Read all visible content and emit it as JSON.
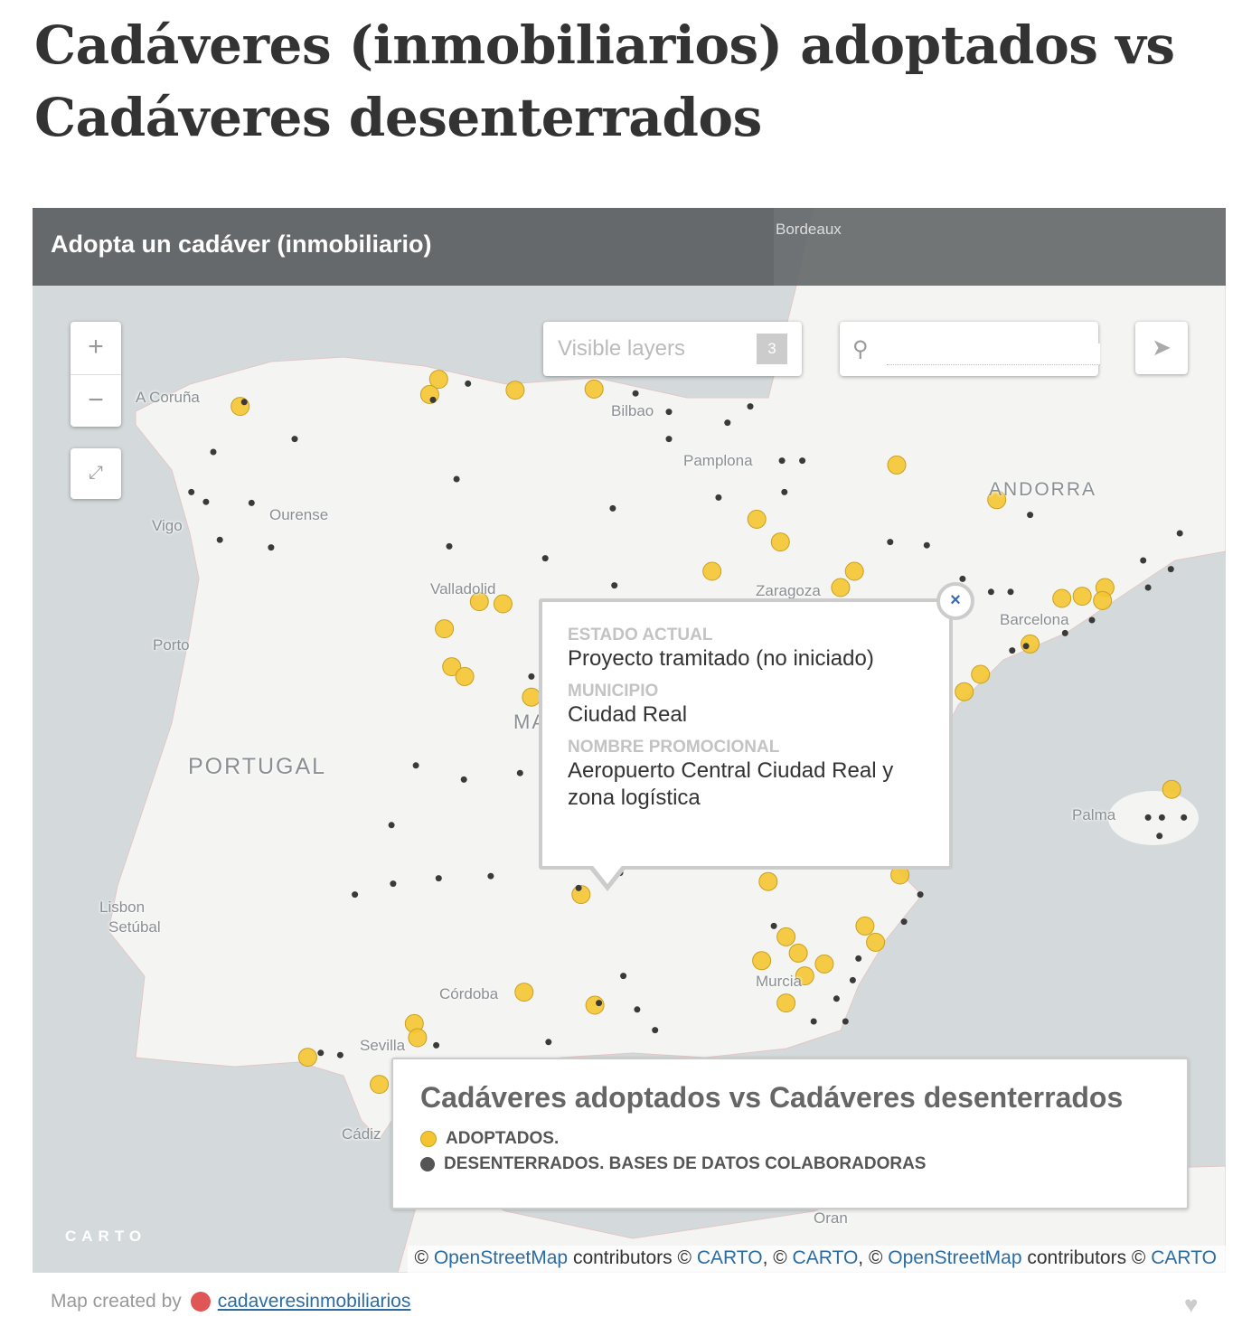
{
  "page": {
    "title": "Cadáveres (inmobiliarios) adoptados vs Cadáveres desenterrados"
  },
  "map": {
    "header": "Adopta un cadáver (inmobiliario)",
    "zoom_in": "+",
    "zoom_out": "−",
    "layers_label": "Visible layers",
    "layers_count": "3",
    "search_placeholder": "",
    "labels": {
      "bordeaux": "Bordeaux",
      "coruna": "A Coruña",
      "vigo": "Vigo",
      "ourense": "Ourense",
      "porto": "Porto",
      "portugal": "PORTUGAL",
      "lisbon": "Lisbon",
      "setubal": "Setúbal",
      "valladolid": "Valladolid",
      "bilbao": "Bilbao",
      "pamplona": "Pamplona",
      "zaragoza": "Zaragoza",
      "andorra": "ANDORRA",
      "barcelona": "Barcelona",
      "palma": "Palma",
      "madrid": "MA",
      "cordoba": "Córdoba",
      "sevilla": "Sevilla",
      "cadiz": "Cádiz",
      "murcia": "Murcia",
      "oran": "Oran"
    },
    "popup": {
      "fields": [
        {
          "key": "ESTADO ACTUAL",
          "value": "Proyecto tramitado (no iniciado)"
        },
        {
          "key": "MUNICIPIO",
          "value": "Ciudad Real"
        },
        {
          "key": "NOMBRE PROMOCIONAL",
          "value": "Aeropuerto Central Ciudad Real y zona logística"
        }
      ],
      "close": "×"
    },
    "legend": {
      "title": "Cadáveres adoptados vs Cadáveres desenterrados",
      "items": [
        {
          "label": "ADOPTADOS.",
          "color": "#f5c531"
        },
        {
          "label": "DESENTERRADOS. BASES DE DATOS COLABORADORAS",
          "color": "#555555"
        }
      ]
    },
    "attribution": {
      "osm": "OpenStreetMap",
      "contributors": " contributors © ",
      "carto": "CARTO",
      "sep": ", © "
    },
    "carto_logo": "CARTO",
    "colors": {
      "sea": "#d4dadc",
      "land": "#f4f4f2",
      "adopted": "#f5c531",
      "unearthed": "#3a3a3a",
      "link": "#2b6ca3"
    },
    "markers_lonlat": {
      "adopted": [
        [
          -7.67,
          43.29
        ],
        [
          -5.23,
          43.54
        ],
        [
          -5.34,
          43.4
        ],
        [
          -4.29,
          43.44
        ],
        [
          -3.32,
          43.45
        ],
        [
          0.4,
          42.75
        ],
        [
          1.63,
          42.43
        ],
        [
          -1.32,
          42.25
        ],
        [
          -1.03,
          42.04
        ],
        [
          -1.87,
          41.77
        ],
        [
          -0.12,
          41.77
        ],
        [
          -4.73,
          41.49
        ],
        [
          -4.44,
          41.47
        ],
        [
          -5.16,
          41.24
        ],
        [
          -5.07,
          40.89
        ],
        [
          -4.91,
          40.8
        ],
        [
          -4.09,
          40.61
        ],
        [
          2.43,
          41.52
        ],
        [
          2.68,
          41.54
        ],
        [
          2.96,
          41.62
        ],
        [
          2.04,
          41.1
        ],
        [
          1.43,
          40.82
        ],
        [
          1.23,
          40.66
        ],
        [
          3.78,
          39.76
        ],
        [
          0.44,
          38.97
        ],
        [
          0.01,
          38.5
        ],
        [
          0.14,
          38.35
        ],
        [
          -0.96,
          38.4
        ],
        [
          -0.81,
          38.25
        ],
        [
          -0.49,
          38.15
        ],
        [
          -1.26,
          38.18
        ],
        [
          -0.73,
          38.04
        ],
        [
          -0.96,
          37.79
        ],
        [
          -4.18,
          37.89
        ],
        [
          -3.31,
          37.77
        ],
        [
          -5.53,
          37.6
        ],
        [
          -5.49,
          37.47
        ],
        [
          -6.84,
          37.29
        ],
        [
          -5.96,
          37.04
        ],
        [
          -0.87,
          36.97
        ],
        [
          -3.48,
          38.79
        ],
        [
          -1.18,
          38.91
        ],
        [
          2.93,
          41.5
        ],
        [
          -0.29,
          41.62
        ]
      ],
      "unearthed": [
        [
          -8.0,
          42.87
        ],
        [
          -8.27,
          42.5
        ],
        [
          -8.09,
          42.41
        ],
        [
          -7.92,
          42.06
        ],
        [
          -7.29,
          41.99
        ],
        [
          -7.0,
          42.99
        ],
        [
          -7.53,
          42.4
        ],
        [
          -4.87,
          43.5
        ],
        [
          -5.01,
          42.62
        ],
        [
          -5.1,
          42.0
        ],
        [
          -3.92,
          41.89
        ],
        [
          -3.09,
          42.35
        ],
        [
          -2.81,
          43.41
        ],
        [
          -2.4,
          43.24
        ],
        [
          -2.4,
          42.99
        ],
        [
          -1.68,
          43.14
        ],
        [
          -1.4,
          43.29
        ],
        [
          -1.01,
          42.79
        ],
        [
          -0.76,
          42.79
        ],
        [
          -0.98,
          42.5
        ],
        [
          -1.79,
          42.45
        ],
        [
          0.32,
          42.04
        ],
        [
          0.77,
          42.01
        ],
        [
          2.04,
          42.29
        ],
        [
          3.43,
          41.87
        ],
        [
          3.77,
          41.79
        ],
        [
          3.88,
          42.12
        ],
        [
          3.49,
          41.62
        ],
        [
          1.8,
          41.58
        ],
        [
          1.56,
          41.58
        ],
        [
          2.47,
          41.2
        ],
        [
          1.82,
          41.04
        ],
        [
          1.21,
          41.7
        ],
        [
          -3.07,
          41.64
        ],
        [
          -4.09,
          40.8
        ],
        [
          -4.23,
          39.91
        ],
        [
          -4.92,
          39.85
        ],
        [
          -5.51,
          39.98
        ],
        [
          -5.81,
          39.43
        ],
        [
          -5.79,
          38.89
        ],
        [
          -5.23,
          38.94
        ],
        [
          -6.26,
          38.79
        ],
        [
          -4.59,
          38.96
        ],
        [
          -3.0,
          38.99
        ],
        [
          -2.96,
          38.04
        ],
        [
          -3.26,
          37.79
        ],
        [
          -3.88,
          37.43
        ],
        [
          -2.57,
          37.54
        ],
        [
          -6.44,
          37.31
        ],
        [
          -6.68,
          37.33
        ],
        [
          -5.26,
          37.4
        ],
        [
          3.49,
          39.5
        ],
        [
          3.66,
          39.5
        ],
        [
          3.93,
          39.5
        ],
        [
          3.63,
          39.33
        ],
        [
          0.69,
          38.79
        ],
        [
          0.49,
          38.54
        ],
        [
          -0.14,
          38.0
        ],
        [
          -0.07,
          38.2
        ],
        [
          -0.34,
          37.83
        ],
        [
          -0.23,
          37.62
        ],
        [
          -0.62,
          37.62
        ],
        [
          -1.11,
          38.5
        ],
        [
          1.99,
          41.08
        ],
        [
          2.8,
          41.32
        ],
        [
          -2.79,
          37.73
        ],
        [
          -3.51,
          38.85
        ],
        [
          -5.3,
          43.35
        ],
        [
          -7.62,
          43.33
        ]
      ]
    }
  },
  "footer": {
    "created_by": "Map created by",
    "author": "cadaveresinmobiliarios"
  }
}
